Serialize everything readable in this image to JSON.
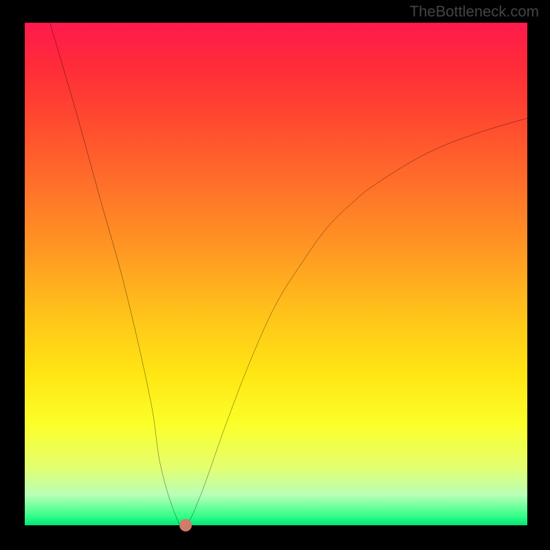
{
  "watermark": "TheBottleneck.com",
  "colors": {
    "page_bg": "#000000",
    "gradient_top": "#ff1a4d",
    "gradient_bottom": "#00e676",
    "curve": "#000000",
    "marker": "#d17a6a",
    "watermark_text": "#444444"
  },
  "chart_data": {
    "type": "line",
    "title": "",
    "xlabel": "",
    "ylabel": "",
    "xlim": [
      0,
      100
    ],
    "ylim": [
      0,
      100
    ],
    "grid": false,
    "legend": false,
    "series": [
      {
        "name": "bottleneck-curve",
        "x": [
          5,
          10,
          15,
          20,
          25,
          27,
          30,
          32,
          35,
          40,
          45,
          50,
          55,
          60,
          65,
          70,
          80,
          90,
          100
        ],
        "y": [
          100,
          83,
          65,
          47,
          25,
          12,
          2,
          0,
          6,
          20,
          33,
          44,
          52,
          59,
          64,
          68,
          74,
          78,
          81
        ]
      }
    ],
    "marker": {
      "x": 32,
      "y": 0
    },
    "notes": "Axes unlabeled in source; x and y expressed as percent of plot width/height. y=0 at bottom (green), y=100 at top (red). Values estimated from pixel positions."
  }
}
